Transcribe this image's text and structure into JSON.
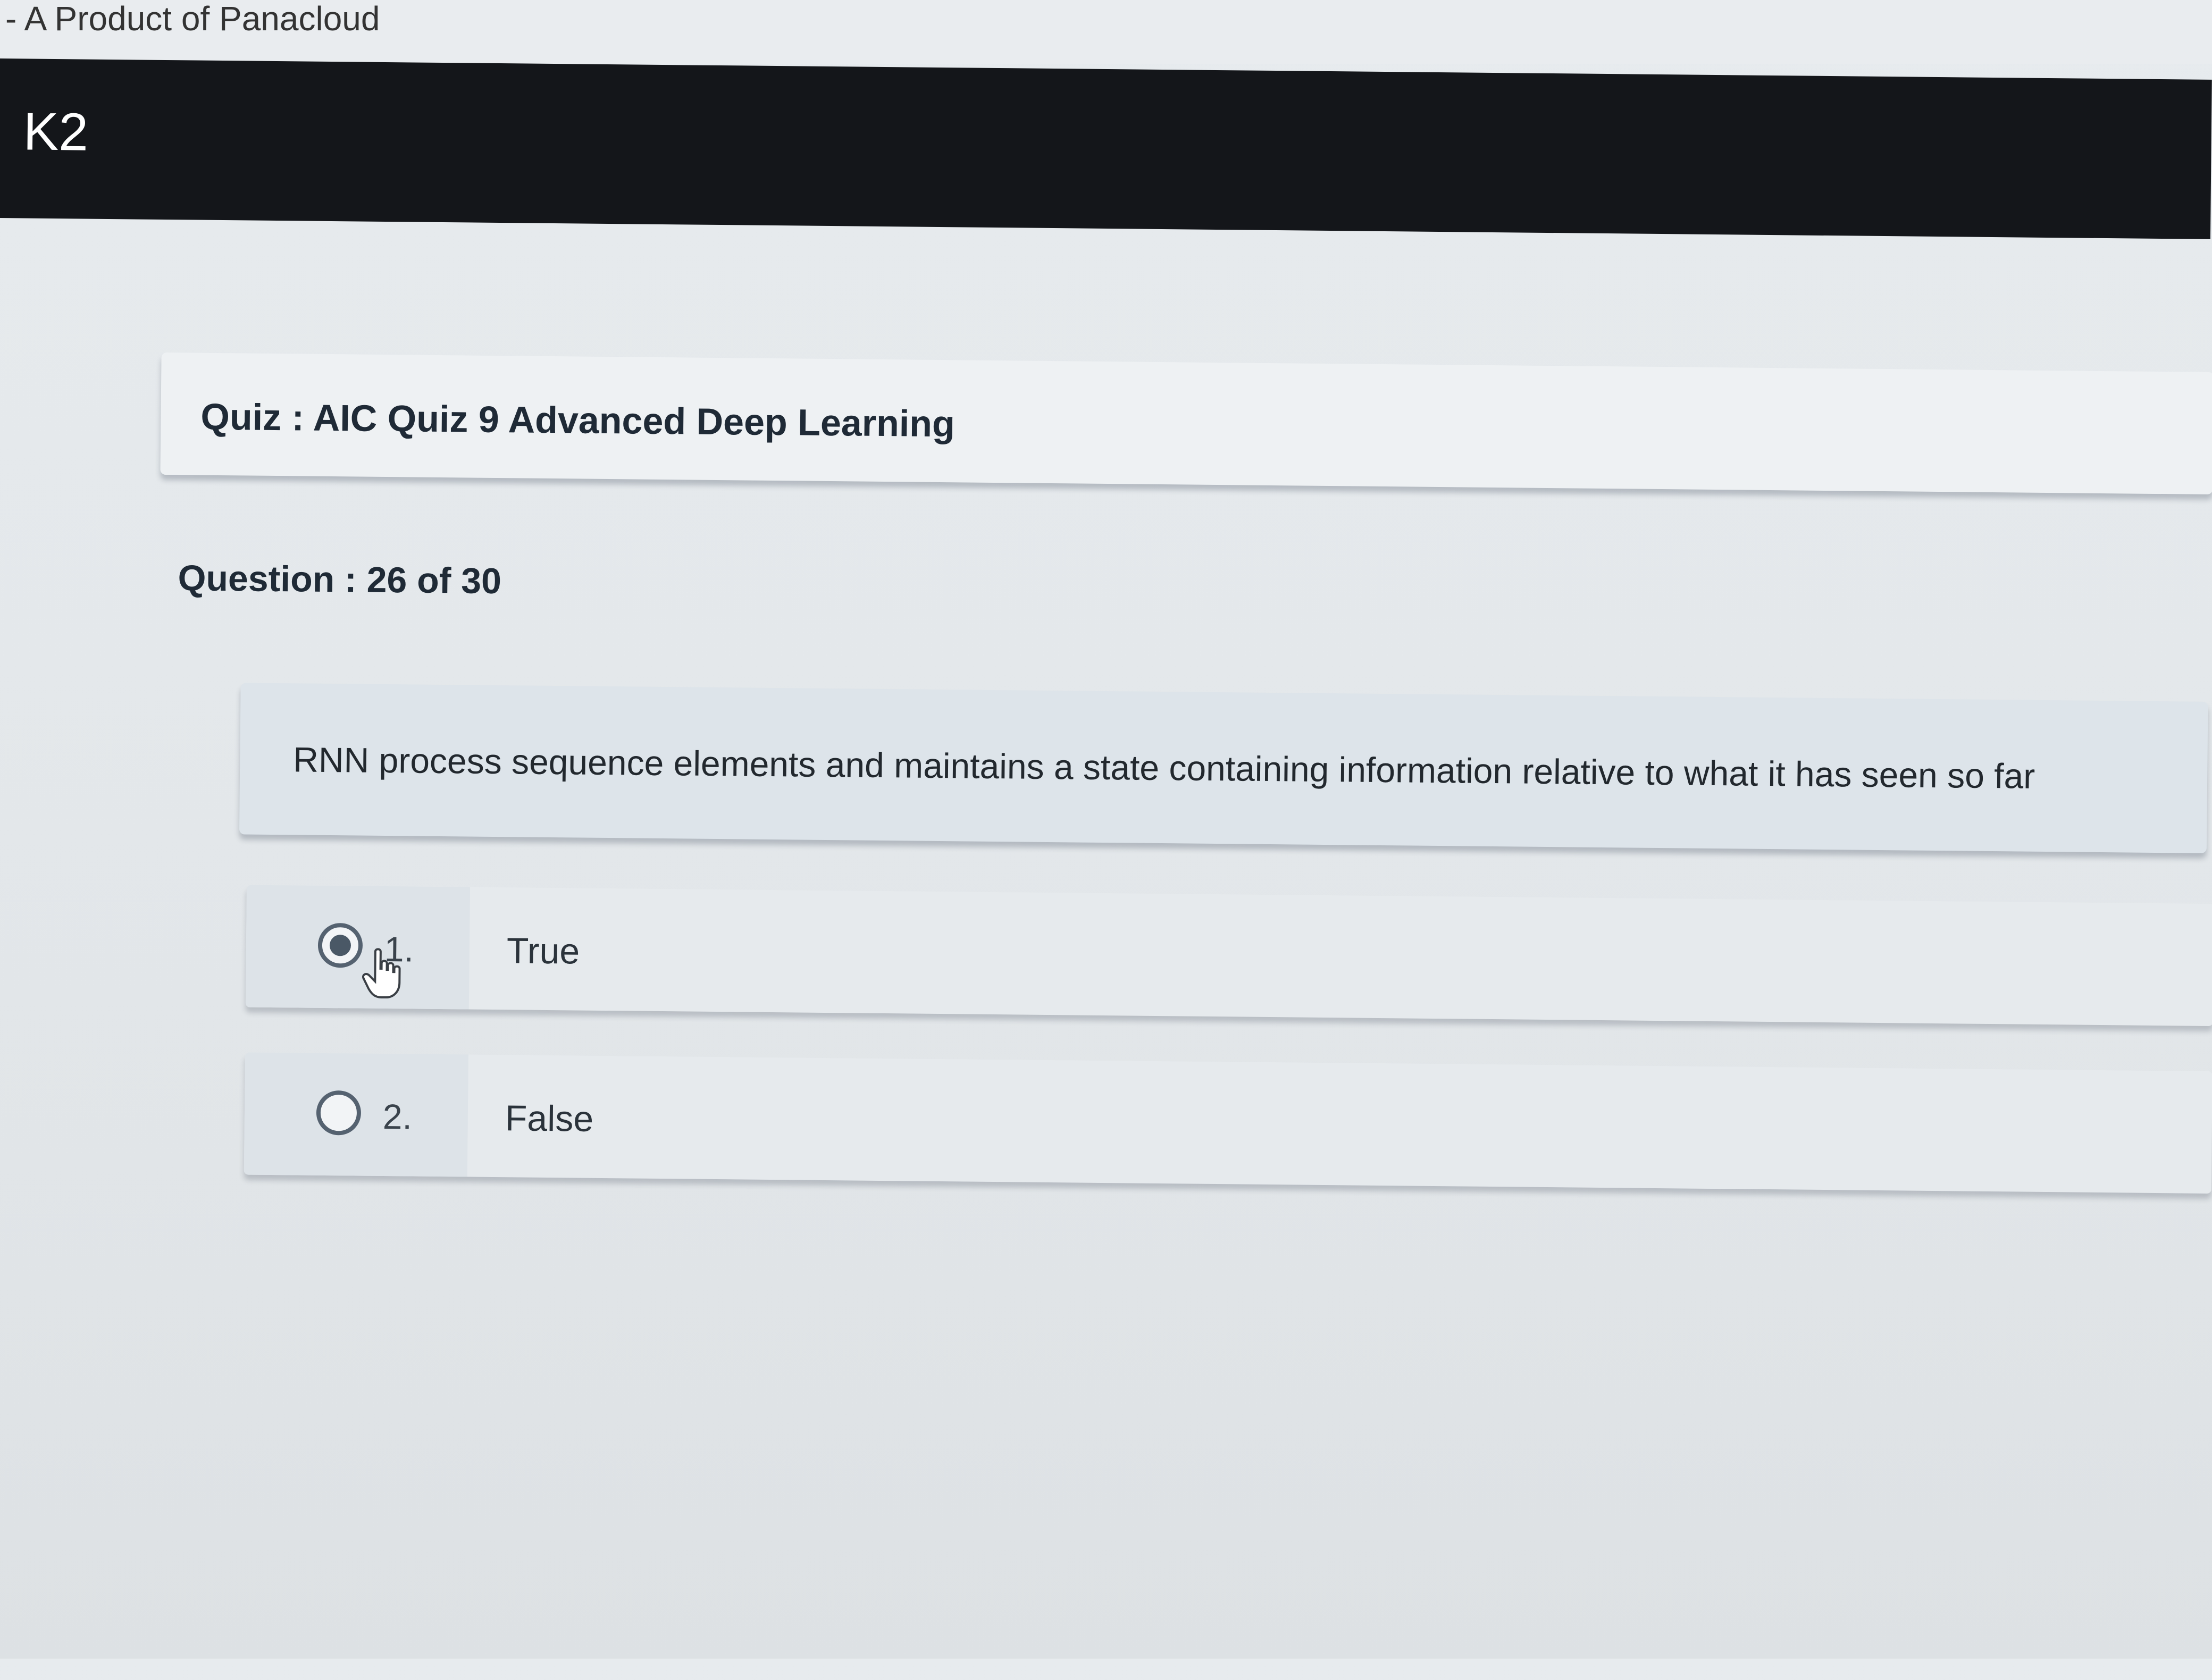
{
  "header": {
    "tagline": "- A Product of Panacloud",
    "logo": "K2"
  },
  "quiz": {
    "title": "Quiz : AIC Quiz 9 Advanced Deep Learning",
    "question_counter": "Question : 26 of 30",
    "question_text": "RNN process sequence elements and maintains a state containing information relative to what it has seen so far",
    "options": [
      {
        "number": "1.",
        "label": "True",
        "selected": true
      },
      {
        "number": "2.",
        "label": "False",
        "selected": false
      }
    ]
  },
  "icons": {
    "cursor": "hand-pointer-icon"
  }
}
